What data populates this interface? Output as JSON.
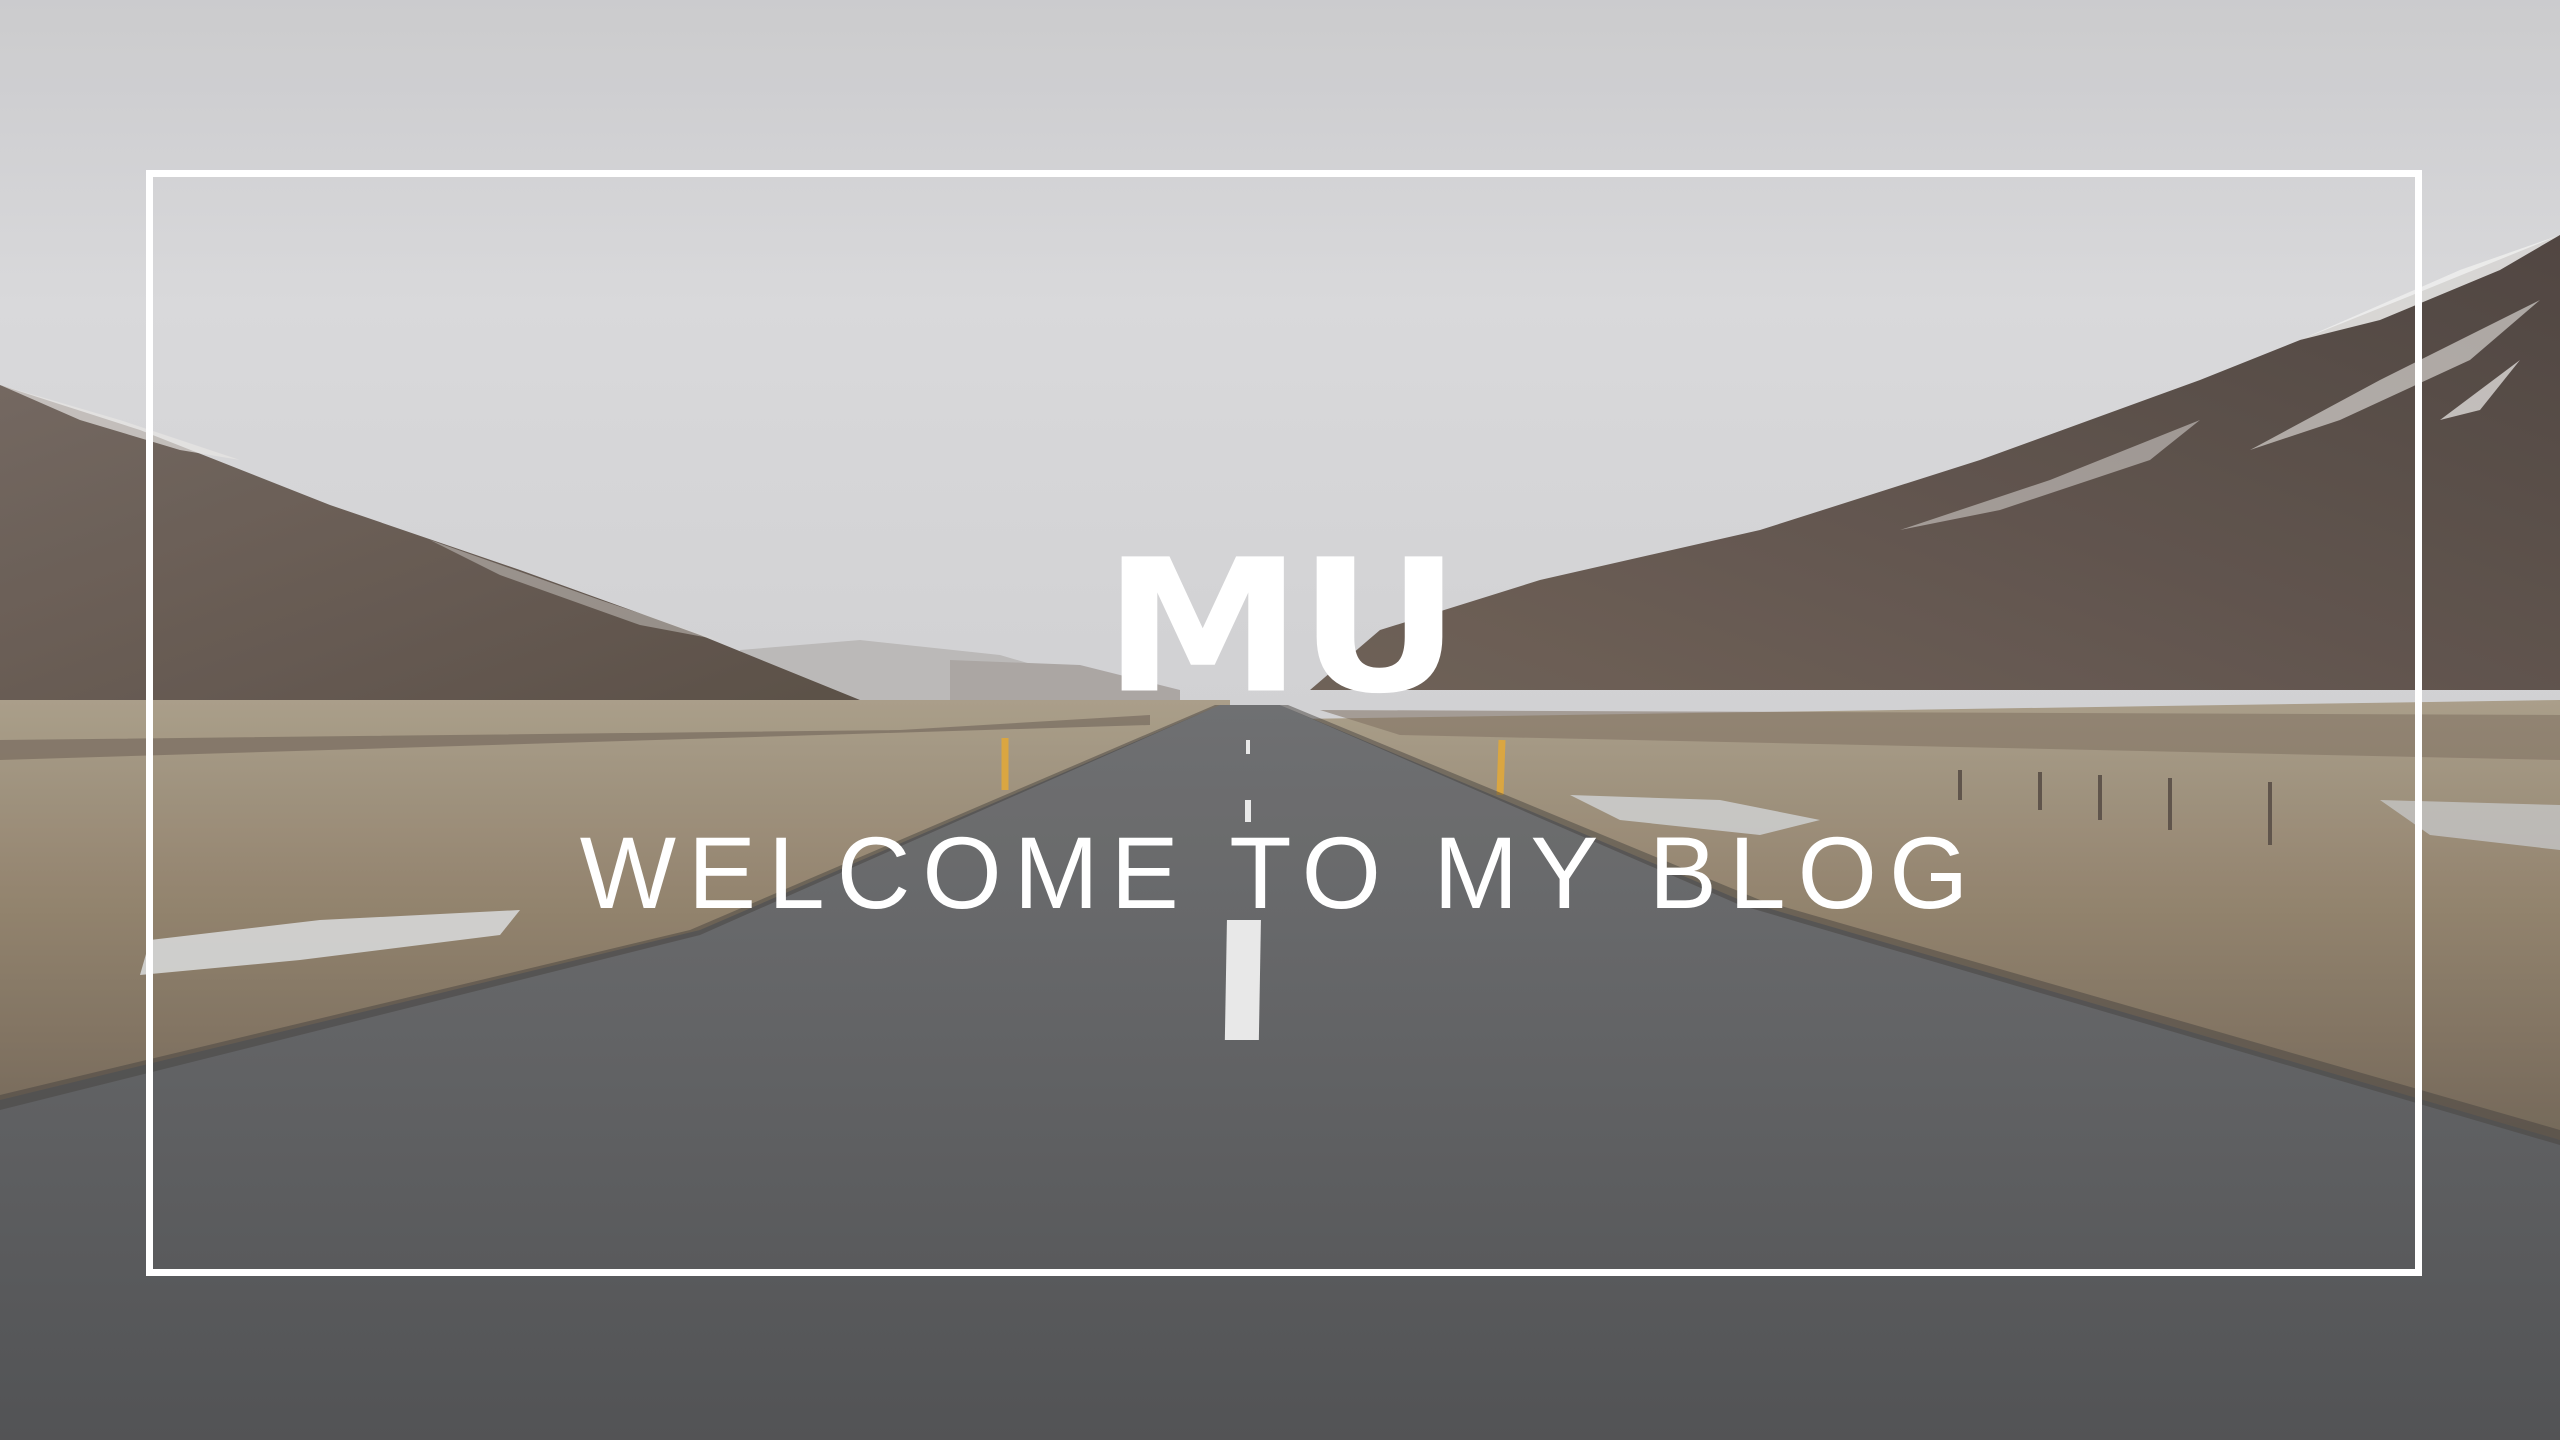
{
  "hero": {
    "logo_text": "MU",
    "tagline": "WELCOME TO MY BLOG"
  },
  "colors": {
    "text": "#ffffff",
    "frame": "#ffffff",
    "sky": "#d6d6d8",
    "road": "#5a5b5d",
    "grass": "#8b7a62",
    "mountain": "#5e524d"
  }
}
